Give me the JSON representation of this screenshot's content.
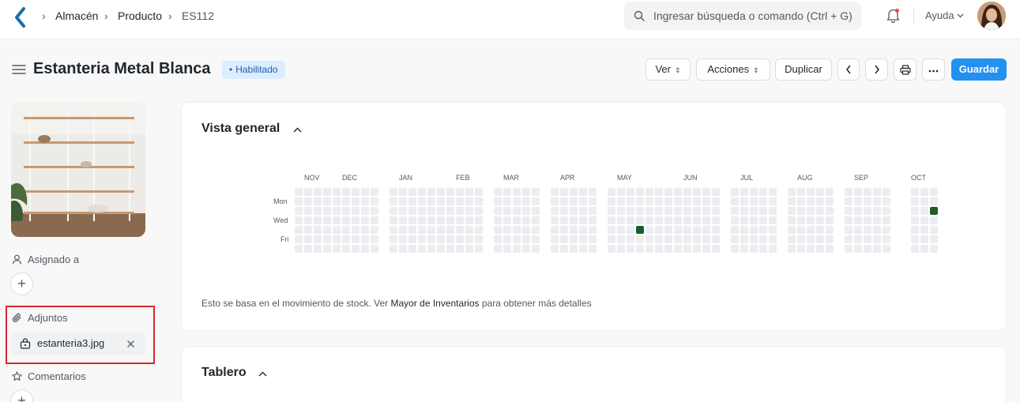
{
  "navbar": {
    "breadcrumbs": [
      "Almacén",
      "Producto",
      "ES112"
    ],
    "search_placeholder": "Ingresar búsqueda o comando (Ctrl + G)",
    "help_label": "Ayuda"
  },
  "page": {
    "title": "Estanteria Metal Blanca",
    "status": "Habilitado"
  },
  "actions": {
    "view": "Ver",
    "actions": "Acciones",
    "duplicate": "Duplicar",
    "save": "Guardar"
  },
  "sidebar": {
    "assigned_label": "Asignado a",
    "attachments_label": "Adjuntos",
    "attachment_file": "estanteria3.jpg",
    "comments_label": "Comentarios"
  },
  "overview": {
    "title": "Vista general",
    "months": [
      "NOV",
      "DEC",
      "JAN",
      "FEB",
      "MAR",
      "APR",
      "MAY",
      "JUN",
      "JUL",
      "AUG",
      "SEP",
      "OCT"
    ],
    "day_labels": [
      "Mon",
      "Wed",
      "Fri"
    ],
    "footnote_prefix": "Esto se basa en el movimiento de stock. Ver ",
    "footnote_link": "Mayor de Inventarios",
    "footnote_suffix": " para obtener más detalles"
  },
  "dashboard": {
    "title": "Tablero"
  },
  "colors": {
    "primary": "#2490ef",
    "heat_empty": "#ebedf0",
    "heat_active": "#1e5a2a",
    "highlight": "#d7262c"
  }
}
